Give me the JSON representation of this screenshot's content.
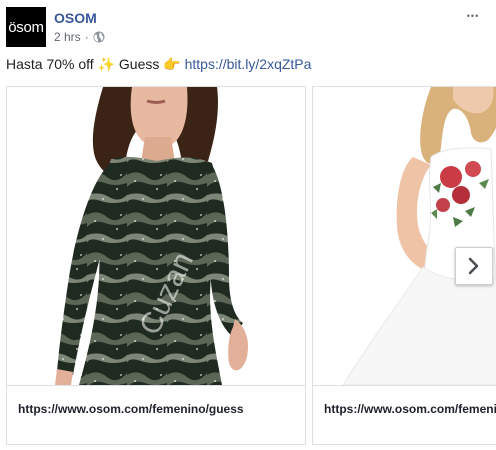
{
  "page": {
    "avatar_text": "ösom",
    "name": "OSOM",
    "time": "2 hrs",
    "separator": "·",
    "more_label": "•••"
  },
  "post": {
    "text_prefix": "Hasta 70% off",
    "emoji_sparkles": "✨",
    "text_mid": "Guess",
    "emoji_hand": "👉",
    "link": "https://bit.ly/2xqZtPa"
  },
  "carousel": {
    "cards": [
      {
        "url": "https://www.osom.com/femenino/guess",
        "image": "woman-sequin-camouflage-dress-photo"
      },
      {
        "url": "https://www.osom.com/femenino/guess",
        "image": "woman-white-floral-dress-photo"
      }
    ],
    "watermark": "Cuzan"
  },
  "colors": {
    "link": "#385898",
    "text": "#1c1e21",
    "meta": "#616770",
    "border": "#dddfe2"
  }
}
